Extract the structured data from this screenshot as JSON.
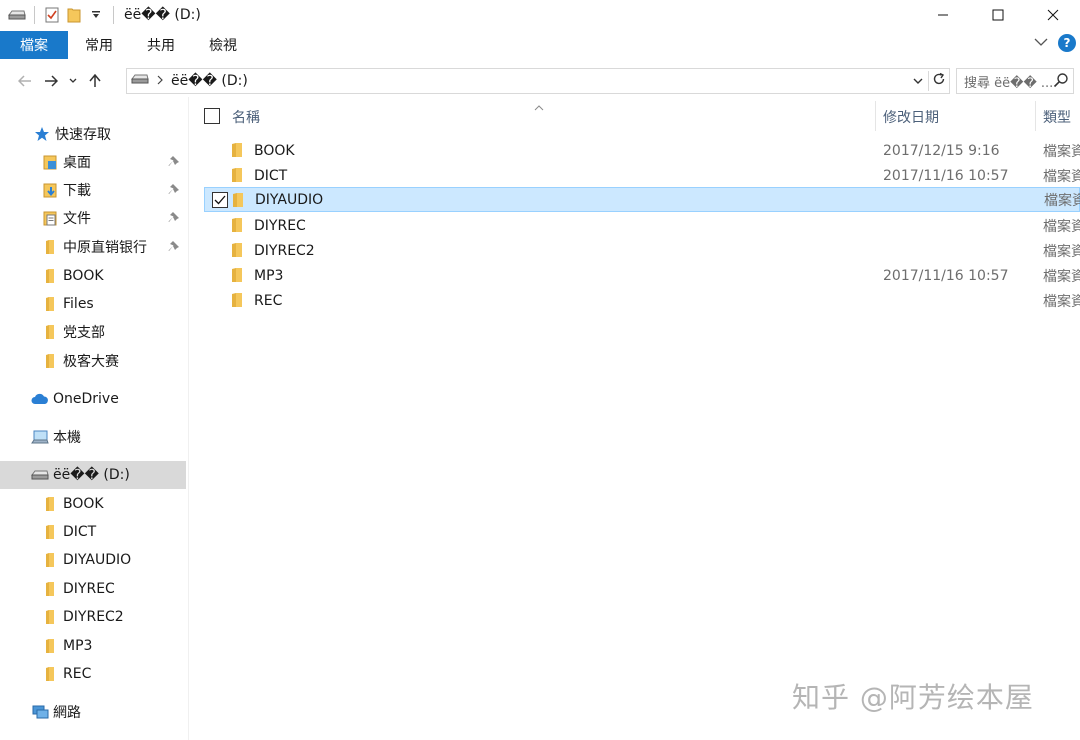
{
  "window": {
    "title": "ëë�� (D:)"
  },
  "ribbon": {
    "tabs": [
      "檔案",
      "常用",
      "共用",
      "檢視"
    ]
  },
  "address": {
    "path": "ëë�� (D:)",
    "search_placeholder": "搜尋 ëë�� ..."
  },
  "columns": {
    "name": "名稱",
    "date": "修改日期",
    "type": "類型"
  },
  "nav": {
    "quick_access": "快速存取",
    "pinned": [
      "桌面",
      "下載",
      "文件",
      "中原直销银行"
    ],
    "quick_folders": [
      "BOOK",
      "Files",
      "党支部",
      "极客大赛"
    ],
    "onedrive": "OneDrive",
    "this_pc": "本機",
    "drive": "ëë�� (D:)",
    "drive_folders": [
      "BOOK",
      "DICT",
      "DIYAUDIO",
      "DIYREC",
      "DIYREC2",
      "MP3",
      "REC"
    ],
    "network": "網路"
  },
  "files": [
    {
      "name": "BOOK",
      "date": "2017/12/15 9:16",
      "type": "檔案資料夾"
    },
    {
      "name": "DICT",
      "date": "2017/11/16 10:57",
      "type": "檔案資料夾"
    },
    {
      "name": "DIYAUDIO",
      "date": "",
      "type": "檔案資料夾"
    },
    {
      "name": "DIYREC",
      "date": "",
      "type": "檔案資料夾"
    },
    {
      "name": "DIYREC2",
      "date": "",
      "type": "檔案資料夾"
    },
    {
      "name": "MP3",
      "date": "2017/11/16 10:57",
      "type": "檔案資料夾"
    },
    {
      "name": "REC",
      "date": "",
      "type": "檔案資料夾"
    }
  ],
  "watermark": "知乎 @阿芳绘本屋",
  "colors": {
    "accent": "#1979ca",
    "selection": "#cce8ff",
    "folder": "#f5c75b"
  }
}
